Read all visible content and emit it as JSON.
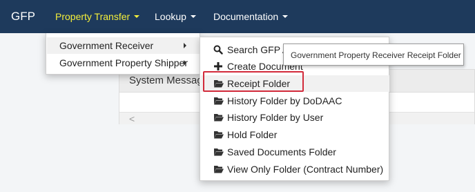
{
  "navbar": {
    "brand": "GFP",
    "items": [
      {
        "label": "Property Transfer",
        "active": true
      },
      {
        "label": "Lookup"
      },
      {
        "label": "Documentation"
      }
    ]
  },
  "panel": {
    "title": "System Messag",
    "scroll_left": "<"
  },
  "submenu": {
    "items": [
      {
        "label": "Government Receiver",
        "has_submenu": true
      },
      {
        "label": "Government Property Shipper",
        "has_submenu": true
      }
    ]
  },
  "receiver_menu": {
    "items": [
      {
        "label": "Search GFP A",
        "icon": "search-icon"
      },
      {
        "label": "Create Document",
        "icon": "plus-icon"
      },
      {
        "label": "Receipt Folder",
        "icon": "folder-open-icon"
      },
      {
        "label": "History Folder by DoDAAC",
        "icon": "folder-open-icon"
      },
      {
        "label": "History Folder by User",
        "icon": "folder-open-icon"
      },
      {
        "label": "Hold Folder",
        "icon": "folder-open-icon"
      },
      {
        "label": "Saved Documents Folder",
        "icon": "folder-open-icon"
      },
      {
        "label": "View Only Folder (Contract Number)",
        "icon": "folder-open-icon"
      }
    ]
  },
  "tooltip": {
    "text": "Government Property Receiver Receipt Folder"
  },
  "colors": {
    "navbar": "#1e3a5c",
    "active_nav": "#f5ef3a",
    "highlight": "#d22a3a"
  }
}
